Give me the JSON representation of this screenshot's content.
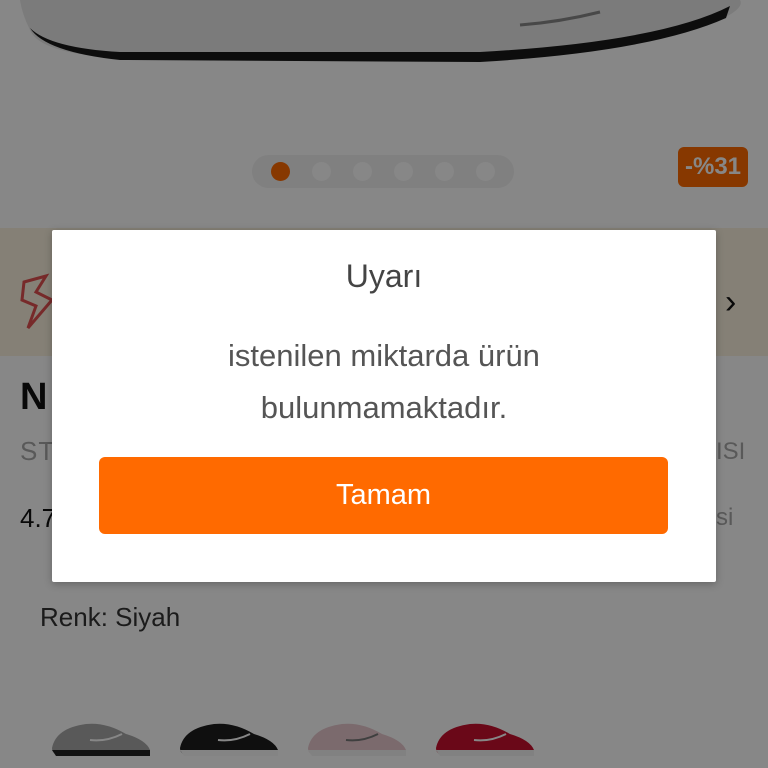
{
  "product": {
    "discount_badge": "-%31",
    "carousel": {
      "total": 6,
      "active_index": 0
    },
    "title_fragment": "N",
    "subtitle_left_fragment": "ST",
    "subtitle_right_fragment": "ISI",
    "rating_fragment": "4.7",
    "right_fragment_2": "si",
    "color_label": "Renk: Siyah",
    "color_options": [
      "gri",
      "siyah",
      "pembe",
      "kırmızı"
    ]
  },
  "dialog": {
    "title": "Uyarı",
    "message_line1": "istenilen miktarda ürün",
    "message_line2": "bulunmamaktadır.",
    "confirm_label": "Tamam"
  },
  "colors": {
    "accent": "#ff6a00",
    "promo_bg": "#fbf2df",
    "overlay": "rgba(0,0,0,0.47)"
  }
}
